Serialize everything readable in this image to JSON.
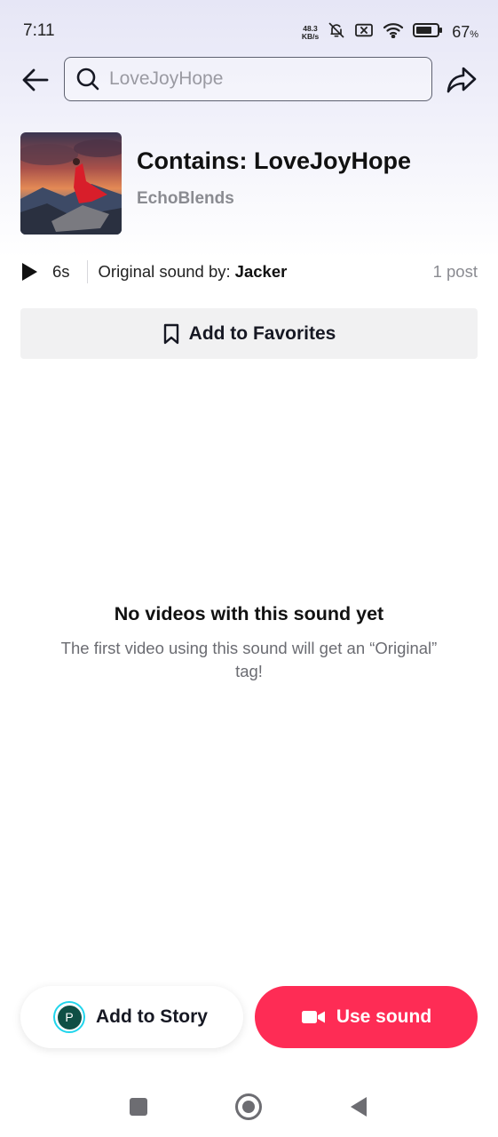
{
  "status_bar": {
    "time": "7:11",
    "net_speed_value": "48.3",
    "net_speed_unit": "KB/s",
    "battery_percent": "67",
    "battery_unit": "%"
  },
  "search": {
    "placeholder": "LoveJoyHope"
  },
  "sound": {
    "title": "Contains: LoveJoyHope",
    "artist": "EchoBlends",
    "duration": "6s",
    "original_label": "Original sound by:",
    "original_author": "Jacker",
    "post_count": "1 post"
  },
  "favorites_button": {
    "label": "Add to Favorites"
  },
  "empty_state": {
    "title": "No videos with this sound yet",
    "description": "The first video using this sound will get an “Original” tag!"
  },
  "actions": {
    "story_avatar_letter": "P",
    "story_label": "Add to Story",
    "use_sound_label": "Use sound"
  },
  "colors": {
    "accent": "#fe2c55",
    "avatar_ring": "#20d5ec"
  },
  "icons": {
    "back": "arrow-left-icon",
    "search": "search-icon",
    "share": "share-arrow-icon",
    "play": "play-icon",
    "bookmark": "bookmark-icon",
    "camera": "video-camera-icon"
  }
}
